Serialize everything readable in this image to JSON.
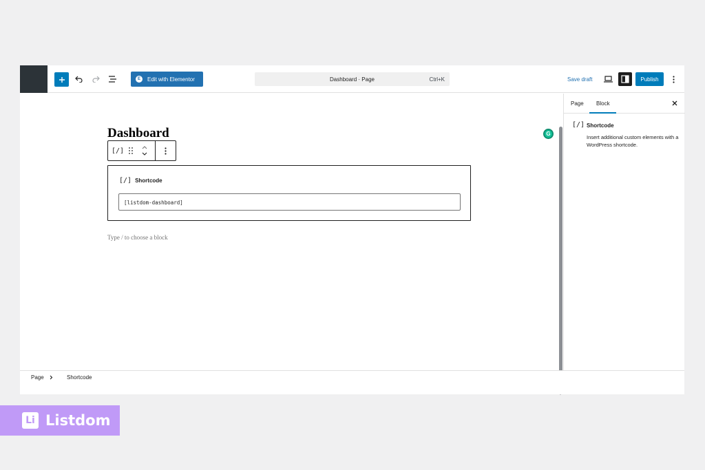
{
  "toolbar": {
    "elementor_label": "Edit with Elementor",
    "command": {
      "title": "Dashboard · Page",
      "shortcut": "Ctrl+K"
    },
    "save_draft": "Save draft",
    "publish": "Publish"
  },
  "canvas": {
    "page_title": "Dashboard",
    "shortcode_block": {
      "icon_glyph": "[/]",
      "label": "Shortcode",
      "value": "[listdom-dashboard]"
    },
    "appender_placeholder": "Type / to choose a block"
  },
  "sidebar": {
    "tabs": [
      {
        "label": "Page",
        "active": false
      },
      {
        "label": "Block",
        "active": true
      }
    ],
    "block_card": {
      "icon_glyph": "[/]",
      "title": "Shortcode",
      "description": "Insert additional custom elements with a WordPress shortcode."
    }
  },
  "footer": {
    "breadcrumb": [
      "Page",
      "Shortcode"
    ]
  },
  "brand": {
    "logo_text": "Li",
    "name": "Listdom"
  },
  "colors": {
    "accent": "#007cba",
    "elementor": "#2271b1",
    "brand": "#c09af7",
    "dark": "#1e1e1e"
  }
}
